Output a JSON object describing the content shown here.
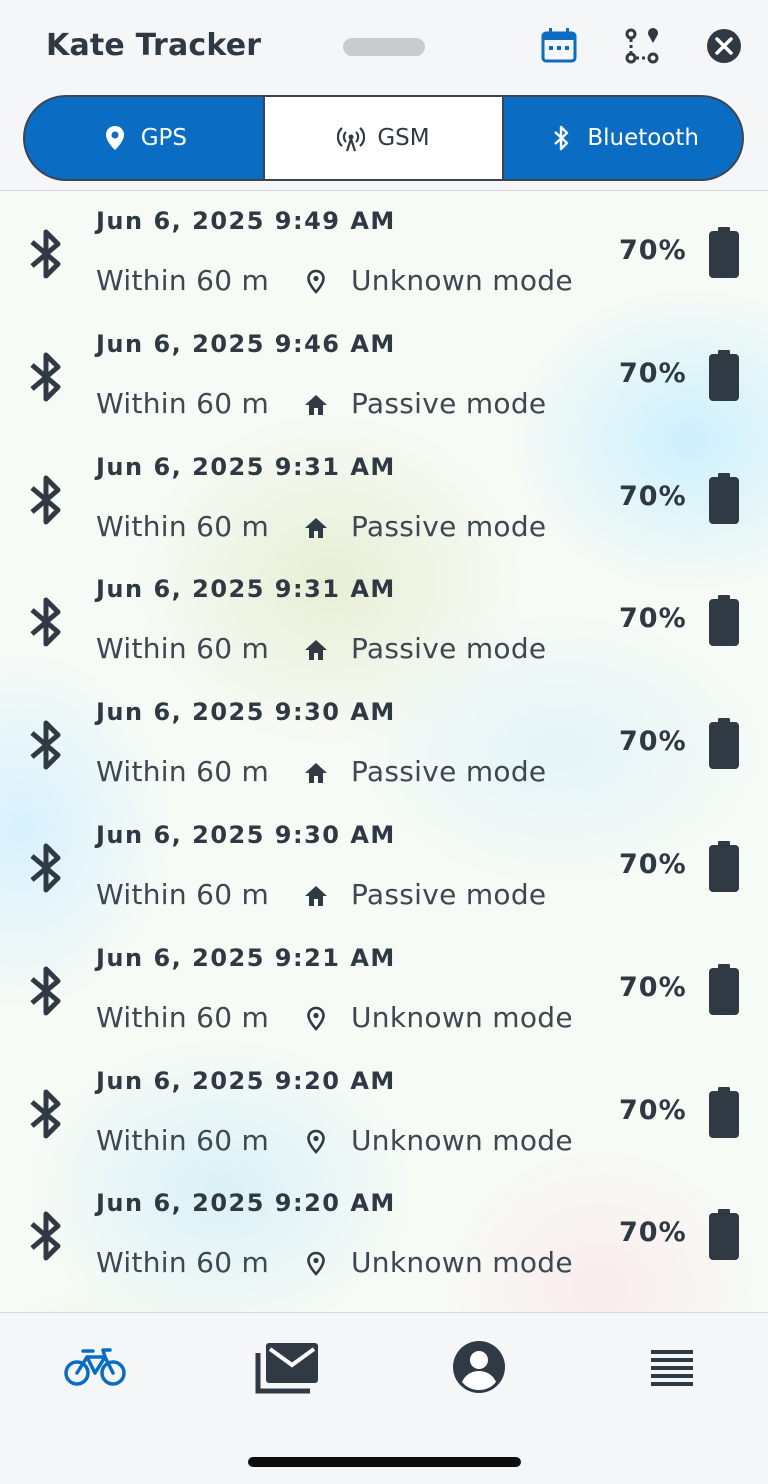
{
  "header": {
    "title": "Kate Tracker",
    "icons": [
      "calendar-icon",
      "route-icon",
      "close-icon"
    ]
  },
  "segments": [
    {
      "label": "GPS",
      "icon": "location-pin-icon",
      "active": false
    },
    {
      "label": "GSM",
      "icon": "cell-tower-icon",
      "active": true
    },
    {
      "label": "Bluetooth",
      "icon": "bluetooth-icon",
      "active": false
    }
  ],
  "rows": [
    {
      "date": "Jun 6, 2025 9:49 AM",
      "distance": "Within 60 m",
      "mode": "Unknown mode",
      "mode_icon": "location-pin-icon",
      "battery": "70%"
    },
    {
      "date": "Jun 6, 2025 9:46 AM",
      "distance": "Within 60 m",
      "mode": "Passive mode",
      "mode_icon": "home-icon",
      "battery": "70%"
    },
    {
      "date": "Jun 6, 2025 9:31 AM",
      "distance": "Within 60 m",
      "mode": "Passive mode",
      "mode_icon": "home-icon",
      "battery": "70%"
    },
    {
      "date": "Jun 6, 2025 9:31 AM",
      "distance": "Within 60 m",
      "mode": "Passive mode",
      "mode_icon": "home-icon",
      "battery": "70%"
    },
    {
      "date": "Jun 6, 2025 9:30 AM",
      "distance": "Within 60 m",
      "mode": "Passive mode",
      "mode_icon": "home-icon",
      "battery": "70%"
    },
    {
      "date": "Jun 6, 2025 9:30 AM",
      "distance": "Within 60 m",
      "mode": "Passive mode",
      "mode_icon": "home-icon",
      "battery": "70%"
    },
    {
      "date": "Jun 6, 2025 9:21 AM",
      "distance": "Within 60 m",
      "mode": "Unknown mode",
      "mode_icon": "location-pin-icon",
      "battery": "70%"
    },
    {
      "date": "Jun 6, 2025 9:20 AM",
      "distance": "Within 60 m",
      "mode": "Unknown mode",
      "mode_icon": "location-pin-icon",
      "battery": "70%"
    },
    {
      "date": "Jun 6, 2025 9:20 AM",
      "distance": "Within 60 m",
      "mode": "Unknown mode",
      "mode_icon": "location-pin-icon",
      "battery": "70%"
    }
  ],
  "tabbar": {
    "items": [
      {
        "icon": "bicycle-icon",
        "active": true
      },
      {
        "icon": "mail-icon",
        "active": false
      },
      {
        "icon": "account-icon",
        "active": false
      },
      {
        "icon": "menu-icon",
        "active": false
      }
    ]
  },
  "colors": {
    "accent": "#0a6cc3",
    "text": "#2e3944",
    "icon_dark": "#2f3a45"
  }
}
